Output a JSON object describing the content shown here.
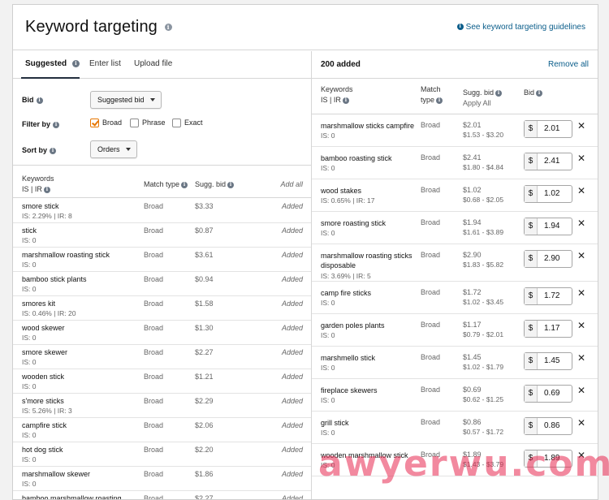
{
  "header": {
    "title": "Keyword targeting",
    "guidelines_link": "See keyword targeting guidelines"
  },
  "tabs": [
    {
      "label": "Suggested",
      "active": true
    },
    {
      "label": "Enter list",
      "active": false
    },
    {
      "label": "Upload file",
      "active": false
    }
  ],
  "controls": {
    "bid_label": "Bid",
    "bid_value": "Suggested bid",
    "filter_label": "Filter by",
    "filters": [
      {
        "label": "Broad",
        "checked": true
      },
      {
        "label": "Phrase",
        "checked": false
      },
      {
        "label": "Exact",
        "checked": false
      }
    ],
    "sort_label": "Sort by",
    "sort_value": "Orders"
  },
  "left_table": {
    "headers": {
      "keywords": "Keywords",
      "is_ir": "IS | IR",
      "match_type": "Match type",
      "sugg_bid": "Sugg. bid",
      "add_all": "Add all"
    },
    "rows": [
      {
        "keyword": "smore stick",
        "is": "IS: 2.29% | IR: 8",
        "match": "Broad",
        "bid": "$3.33",
        "status": "Added"
      },
      {
        "keyword": "stick",
        "is": "IS: 0",
        "match": "Broad",
        "bid": "$0.87",
        "status": "Added"
      },
      {
        "keyword": "marshmallow roasting stick",
        "is": "IS: 0",
        "match": "Broad",
        "bid": "$3.61",
        "status": "Added"
      },
      {
        "keyword": "bamboo stick plants",
        "is": "IS: 0",
        "match": "Broad",
        "bid": "$0.94",
        "status": "Added"
      },
      {
        "keyword": "smores kit",
        "is": "IS: 0.46% | IR: 20",
        "match": "Broad",
        "bid": "$1.58",
        "status": "Added"
      },
      {
        "keyword": "wood skewer",
        "is": "IS: 0",
        "match": "Broad",
        "bid": "$1.30",
        "status": "Added"
      },
      {
        "keyword": "smore skewer",
        "is": "IS: 0",
        "match": "Broad",
        "bid": "$2.27",
        "status": "Added"
      },
      {
        "keyword": "wooden stick",
        "is": "IS: 0",
        "match": "Broad",
        "bid": "$1.21",
        "status": "Added"
      },
      {
        "keyword": "s'more sticks",
        "is": "IS: 5.26% | IR: 3",
        "match": "Broad",
        "bid": "$2.29",
        "status": "Added"
      },
      {
        "keyword": "campfire stick",
        "is": "IS: 0",
        "match": "Broad",
        "bid": "$2.06",
        "status": "Added"
      },
      {
        "keyword": "hot dog stick",
        "is": "IS: 0",
        "match": "Broad",
        "bid": "$2.20",
        "status": "Added"
      },
      {
        "keyword": "marshmallow skewer",
        "is": "IS: 0",
        "match": "Broad",
        "bid": "$1.86",
        "status": "Added"
      },
      {
        "keyword": "bamboo marshmallow roasting",
        "is": "",
        "match": "Broad",
        "bid": "$2.27",
        "status": "Added"
      }
    ]
  },
  "right_table": {
    "added_count": "200 added",
    "remove_all": "Remove all",
    "headers": {
      "keywords": "Keywords",
      "is_ir": "IS | IR",
      "match_type_1": "Match",
      "match_type_2": "type",
      "sugg_bid": "Sugg. bid",
      "apply_all": "Apply All",
      "bid": "Bid"
    },
    "currency": "$",
    "rows": [
      {
        "keyword": "marshmallow sticks campfire",
        "is": "IS: 0",
        "match": "Broad",
        "bid": "$2.01",
        "range": "$1.53 - $3.20",
        "value": "2.01",
        "tall": false
      },
      {
        "keyword": "bamboo roasting stick",
        "is": "IS: 0",
        "match": "Broad",
        "bid": "$2.41",
        "range": "$1.80 - $4.84",
        "value": "2.41",
        "tall": false
      },
      {
        "keyword": "wood stakes",
        "is": "IS: 0.65% | IR: 17",
        "match": "Broad",
        "bid": "$1.02",
        "range": "$0.68 - $2.05",
        "value": "1.02",
        "tall": false
      },
      {
        "keyword": "smore roasting stick",
        "is": "IS: 0",
        "match": "Broad",
        "bid": "$1.94",
        "range": "$1.61 - $3.89",
        "value": "1.94",
        "tall": false
      },
      {
        "keyword": "marshmallow roasting sticks disposable",
        "is": "IS: 3.69% | IR: 5",
        "match": "Broad",
        "bid": "$2.90",
        "range": "$1.83 - $5.82",
        "value": "2.90",
        "tall": true
      },
      {
        "keyword": "camp fire sticks",
        "is": "IS: 0",
        "match": "Broad",
        "bid": "$1.72",
        "range": "$1.02 - $3.45",
        "value": "1.72",
        "tall": false
      },
      {
        "keyword": "garden poles plants",
        "is": "IS: 0",
        "match": "Broad",
        "bid": "$1.17",
        "range": "$0.79 - $2.01",
        "value": "1.17",
        "tall": false
      },
      {
        "keyword": "marshmello stick",
        "is": "IS: 0",
        "match": "Broad",
        "bid": "$1.45",
        "range": "$1.02 - $1.79",
        "value": "1.45",
        "tall": false
      },
      {
        "keyword": "fireplace skewers",
        "is": "IS: 0",
        "match": "Broad",
        "bid": "$0.69",
        "range": "$0.62 - $1.25",
        "value": "0.69",
        "tall": false
      },
      {
        "keyword": "grill stick",
        "is": "IS: 0",
        "match": "Broad",
        "bid": "$0.86",
        "range": "$0.57 - $1.72",
        "value": "0.86",
        "tall": false
      },
      {
        "keyword": "wooden marshmallow stick",
        "is": "IS: 0",
        "match": "Broad",
        "bid": "$1.89",
        "range": "$1.43 - $3.79",
        "value": "1.89",
        "tall": false
      }
    ]
  },
  "watermark": "awyerwu.com",
  "colors": {
    "link": "#0a5d8a",
    "checkbox_accent": "#e77600",
    "watermark": "#e82850"
  }
}
